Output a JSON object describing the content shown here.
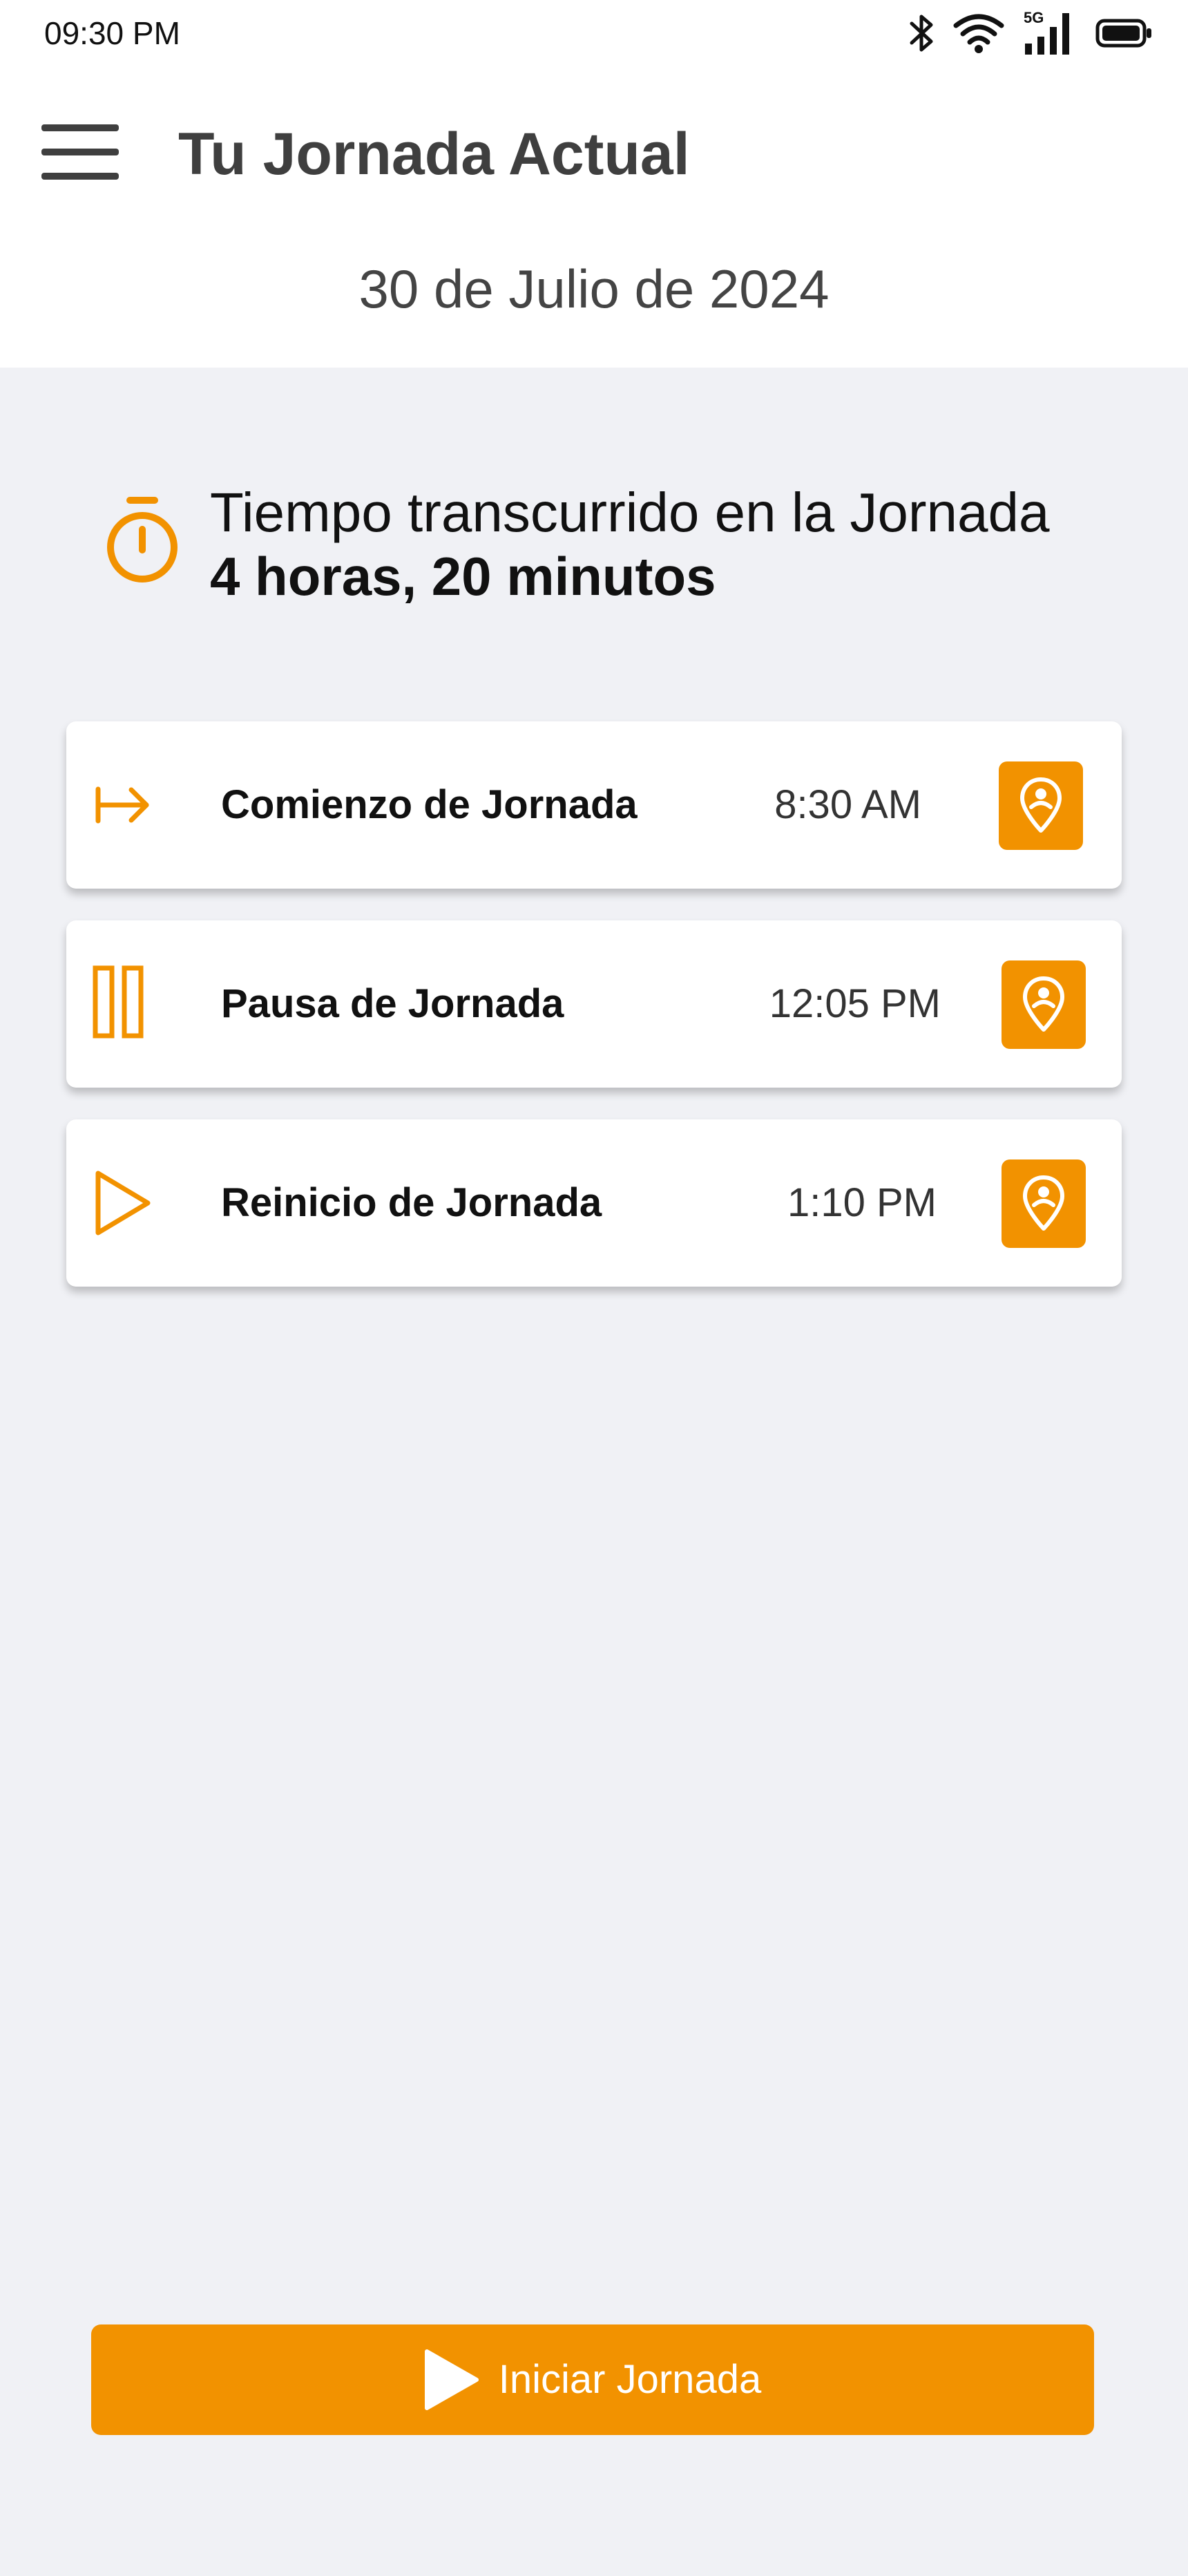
{
  "status_bar": {
    "time": "09:30 PM",
    "network_label": "5G",
    "icons": [
      "bluetooth-icon",
      "wifi-icon",
      "signal-icon",
      "battery-icon"
    ]
  },
  "header": {
    "menu_icon": "hamburger-menu-icon",
    "title": "Tu Jornada Actual",
    "date": "30 de Julio de 2024"
  },
  "elapsed": {
    "icon": "stopwatch-icon",
    "label": "Tiempo transcurrido en la Jornada",
    "value": "4 horas, 20 minutos"
  },
  "events": [
    {
      "icon": "arrow-right-to-bar-icon",
      "label": "Comienzo de Jornada",
      "time": "8:30 AM",
      "location_icon": "location-pin-icon"
    },
    {
      "icon": "pause-icon",
      "label": "Pausa de Jornada",
      "time": "12:05 PM",
      "location_icon": "location-pin-icon"
    },
    {
      "icon": "play-icon",
      "label": "Reinicio de Jornada",
      "time": "1:10 PM",
      "location_icon": "location-pin-icon"
    }
  ],
  "action_button": {
    "icon": "play-icon",
    "label": "Iniciar Jornada"
  },
  "colors": {
    "accent": "#f29200",
    "background": "#f0f1f5",
    "surface": "#ffffff",
    "title_text": "#3f3f3f"
  }
}
